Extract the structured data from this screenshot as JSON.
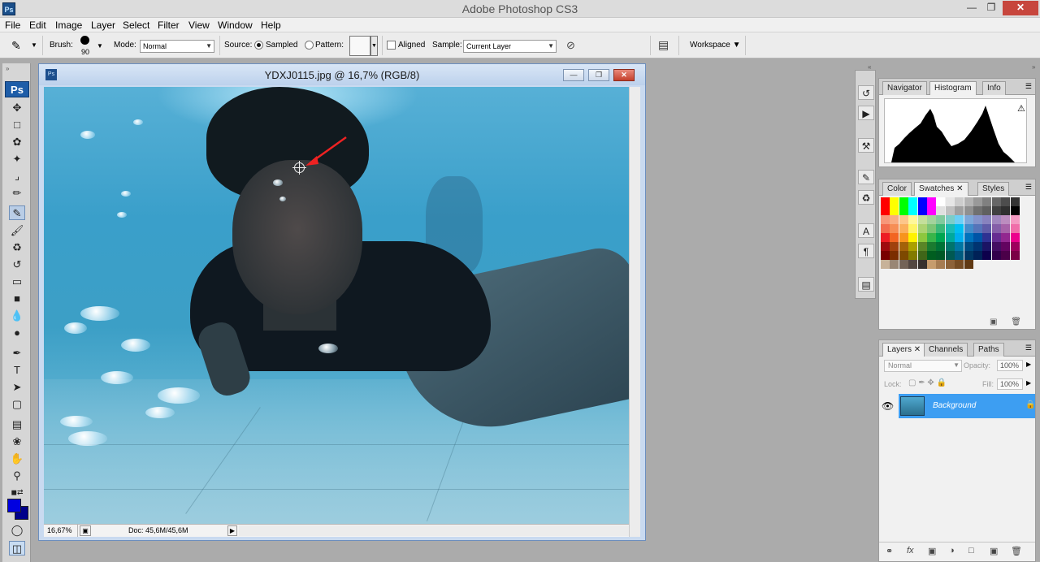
{
  "app": {
    "title": "Adobe Photoshop CS3",
    "logo": "Ps"
  },
  "window_controls": {
    "minimize_icon": "minimize-icon",
    "maximize_icon": "maximize-icon",
    "close_icon": "close-icon"
  },
  "menu": [
    "File",
    "Edit",
    "Image",
    "Layer",
    "Select",
    "Filter",
    "View",
    "Window",
    "Help"
  ],
  "options": {
    "brush_label": "Brush:",
    "brush_size": "90",
    "mode_label": "Mode:",
    "mode_value": "Normal",
    "source_label": "Source:",
    "sampled_label": "Sampled",
    "pattern_label": "Pattern:",
    "aligned_label": "Aligned",
    "sample_label": "Sample:",
    "sample_value": "Current Layer",
    "workspace_label": "Workspace"
  },
  "tools": {
    "badge": "Ps"
  },
  "document": {
    "title": "YDXJ0115.jpg @ 16,7% (RGB/8)",
    "zoom": "16,67%",
    "doc_size": "Doc: 45,6M/45,6M"
  },
  "histogram_panel": {
    "tabs": [
      "Navigator",
      "Histogram",
      "Info"
    ],
    "active": "Histogram"
  },
  "swatches_panel": {
    "tabs": [
      "Color",
      "Swatches",
      "Styles"
    ],
    "active": "Swatches",
    "colors": [
      [
        "#ff0000",
        "#ffff00",
        "#00ff00",
        "#00ffff",
        "#0000ff",
        "#ff00ff",
        "#ffffff",
        "#e6e6e6",
        "#cccccc",
        "#b3b3b3",
        "#999999",
        "#808080",
        "#666666",
        "#4d4d4d",
        "#333333"
      ],
      [
        "#ff0000",
        "#ffff00",
        "#00ff00",
        "#00ffff",
        "#0000ff",
        "#ff00ff",
        "#e0e0e0",
        "#c0c0c0",
        "#a0a0a0",
        "#909090",
        "#707070",
        "#606060",
        "#404040",
        "#303030",
        "#000000"
      ],
      [
        "#f7977a",
        "#f9ad81",
        "#fdc68a",
        "#fff79a",
        "#c4df9b",
        "#a3d39c",
        "#82ca9d",
        "#7bcdc8",
        "#6ecff6",
        "#7ea7d8",
        "#8493ca",
        "#8882be",
        "#a187be",
        "#bc8dbf",
        "#f49ac2"
      ],
      [
        "#f26c4f",
        "#f68e55",
        "#fbaf5c",
        "#fff467",
        "#acd372",
        "#7cc576",
        "#3bb878",
        "#1abbb4",
        "#00bff3",
        "#438cca",
        "#5574b9",
        "#605ca8",
        "#855fa8",
        "#a763a8",
        "#f06ea9"
      ],
      [
        "#ed1c24",
        "#f26522",
        "#f7941d",
        "#fff200",
        "#8dc73f",
        "#39b54a",
        "#00a651",
        "#00a99d",
        "#00aeef",
        "#0072bc",
        "#0054a6",
        "#2e3192",
        "#662d91",
        "#92278f",
        "#ec008c"
      ],
      [
        "#9e0b0f",
        "#a0410d",
        "#a36209",
        "#aba000",
        "#598527",
        "#1a7b30",
        "#007236",
        "#00746b",
        "#0076a3",
        "#004b80",
        "#003471",
        "#1b1464",
        "#440e62",
        "#630460",
        "#9e005d"
      ],
      [
        "#790000",
        "#7b2e00",
        "#7d4900",
        "#827b00",
        "#406618",
        "#005e20",
        "#005826",
        "#005952",
        "#005b7f",
        "#003663",
        "#002157",
        "#0d004c",
        "#32004b",
        "#4b0049",
        "#7b0046"
      ],
      [
        "#c7b299",
        "#998675",
        "#736357",
        "#534741",
        "#37302d",
        "#c69c6d",
        "#a67c52",
        "#8c6239",
        "#754c24",
        "#603913"
      ]
    ]
  },
  "layers_panel": {
    "tabs": [
      "Layers",
      "Channels",
      "Paths"
    ],
    "active": "Layers",
    "blend_mode": "Normal",
    "opacity_label": "Opacity:",
    "opacity_value": "100%",
    "lock_label": "Lock:",
    "fill_label": "Fill:",
    "fill_value": "100%",
    "layer_name": "Background"
  },
  "colors": {
    "foreground": "#0000e0",
    "background": "#00008a",
    "highlight": "#3d9ef2"
  }
}
